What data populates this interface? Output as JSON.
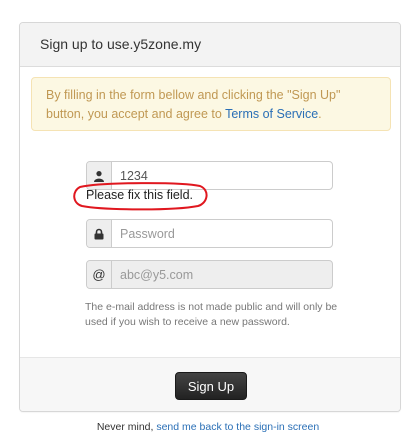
{
  "panel": {
    "title": "Sign up to use.y5zone.my"
  },
  "notice": {
    "text_before": "By filling in the form bellow and clicking the \"Sign Up\" button, you accept and agree to ",
    "tos_link": "Terms of Service",
    "text_after": "."
  },
  "form": {
    "username": {
      "value": "1234",
      "icon": "user-icon"
    },
    "username_error": "Please fix this field.",
    "password": {
      "placeholder": "Password",
      "icon": "lock-icon"
    },
    "email": {
      "placeholder": "abc@y5.com",
      "icon_glyph": "@",
      "disabled": true
    },
    "help_text": "The e-mail address is not made public and will only be used if you wish to receive a new password.",
    "submit_label": "Sign Up"
  },
  "footer": {
    "text": "Never mind, ",
    "link": "send me back to the sign-in screen"
  },
  "colors": {
    "notice_bg": "#fcf8e3",
    "notice_text": "#c09853",
    "link": "#2a6fb6",
    "error_circle": "#e0171f",
    "button_bg": "#333333"
  }
}
